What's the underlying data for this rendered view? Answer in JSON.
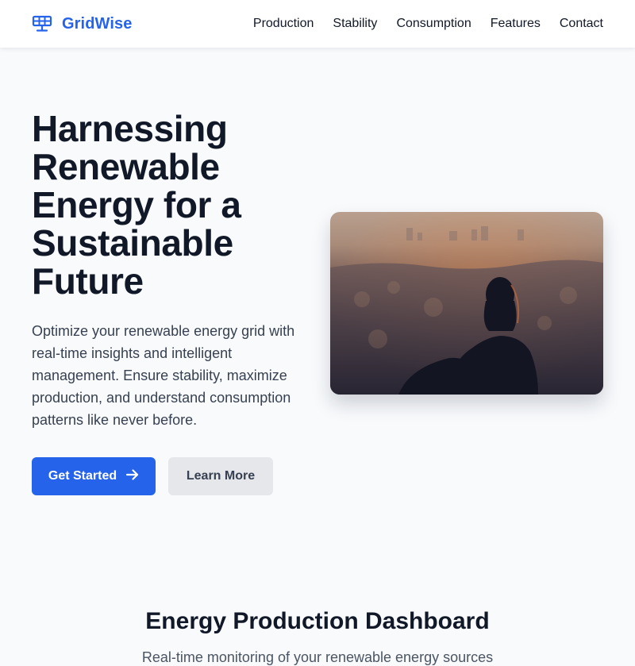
{
  "header": {
    "brand": "GridWise",
    "brand_icon": "solar-panel-icon",
    "brand_color": "#2563eb",
    "nav": [
      {
        "label": "Production"
      },
      {
        "label": "Stability"
      },
      {
        "label": "Consumption"
      },
      {
        "label": "Features"
      },
      {
        "label": "Contact"
      }
    ]
  },
  "hero": {
    "title": "Harnessing Renewable Energy for a Sustainable Future",
    "description": "Optimize your renewable energy grid with real-time insights and intelligent management. Ensure stability, maximize production, and understand consumption patterns like never before.",
    "primary_button": "Get Started",
    "primary_button_icon": "arrow-right-icon",
    "secondary_button": "Learn More",
    "image": "person-overlooking-city-at-sunset-photo"
  },
  "dashboard": {
    "title": "Energy Production Dashboard",
    "subtitle": "Real-time monitoring of your renewable energy sources"
  }
}
